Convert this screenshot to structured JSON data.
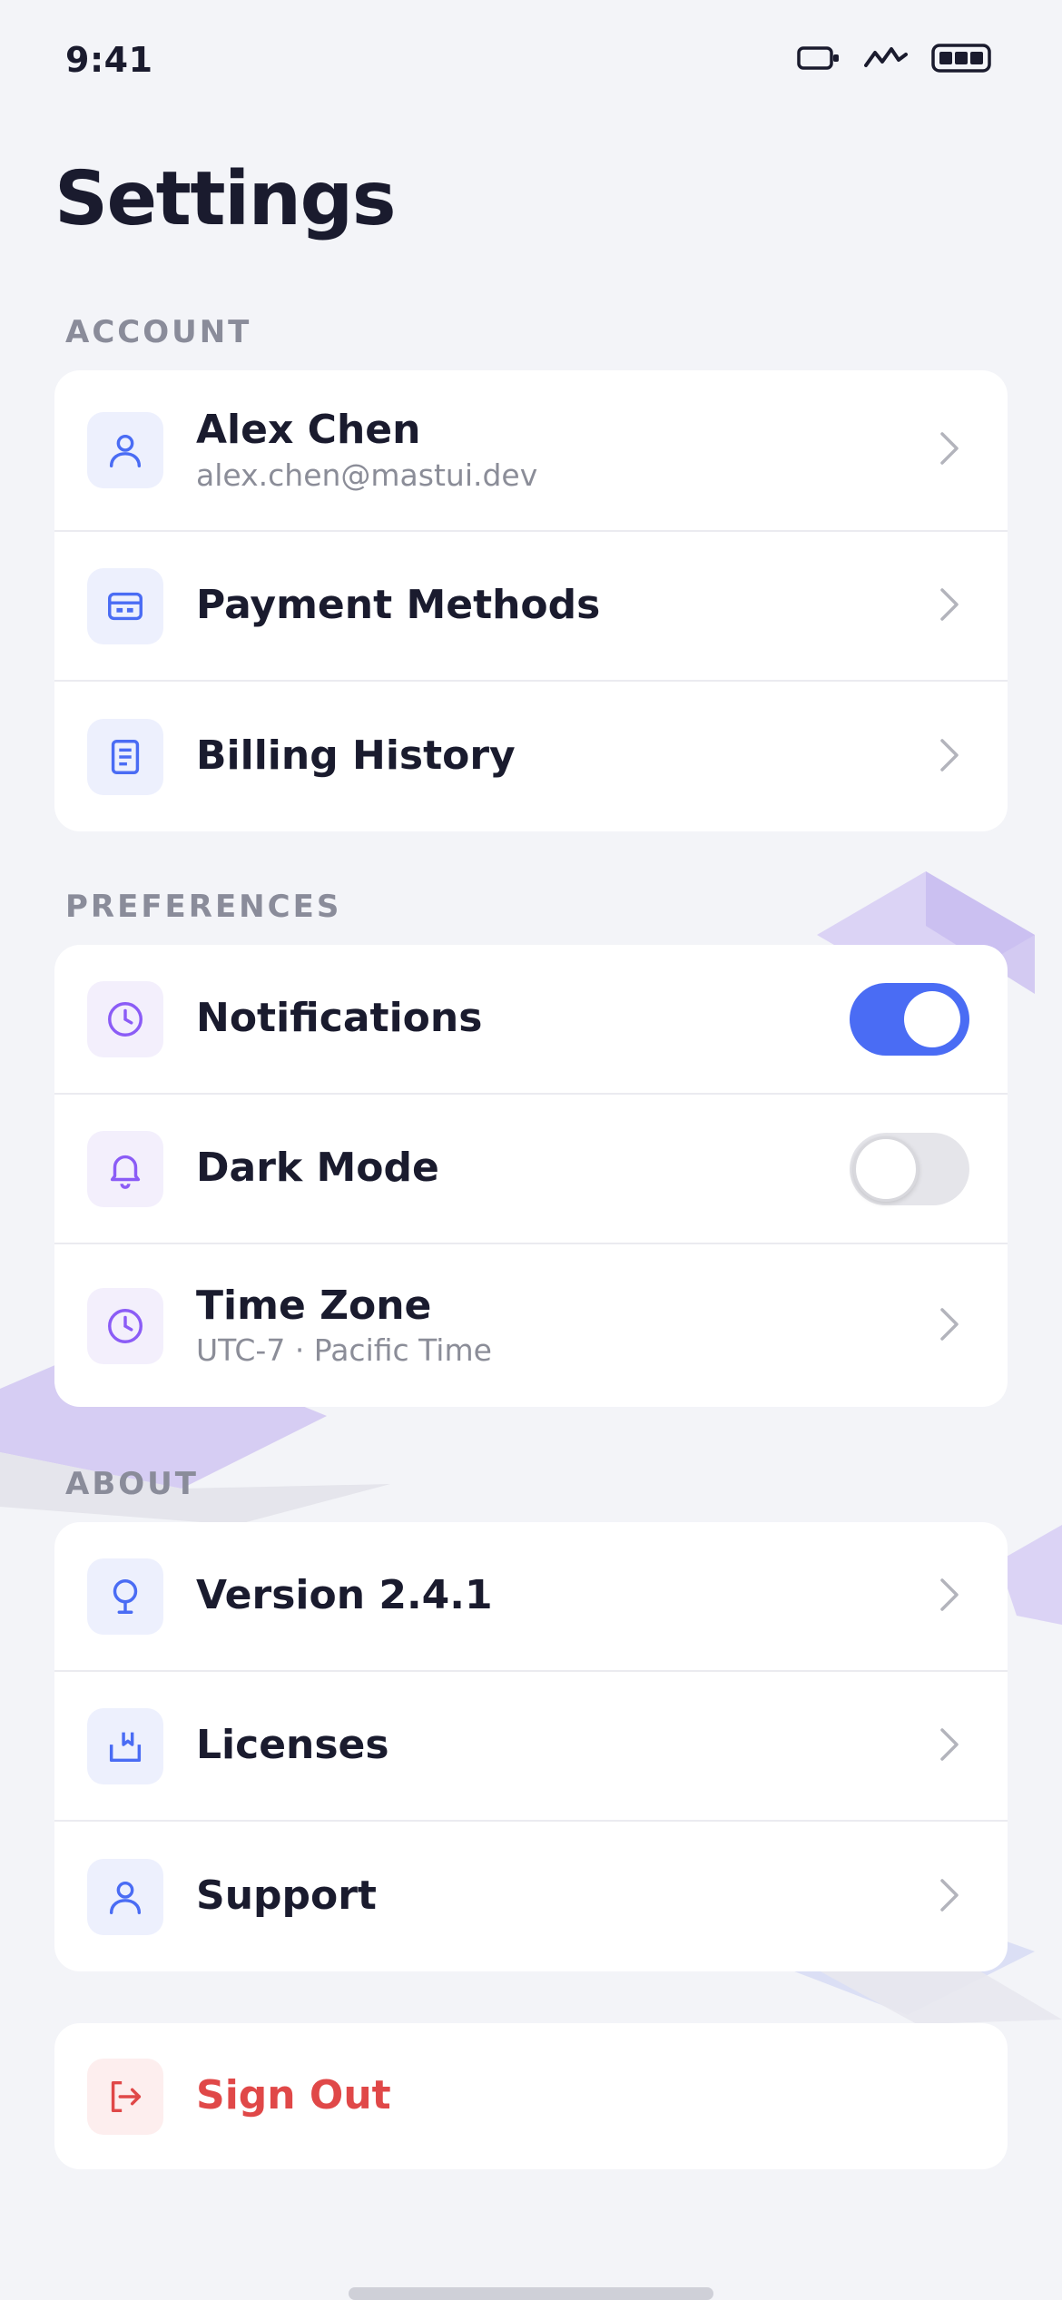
{
  "status_bar": {
    "time": "9:41"
  },
  "page": {
    "title": "Settings"
  },
  "sections": {
    "account": {
      "header": "ACCOUNT",
      "profile": {
        "name": "Alex Chen",
        "email": "alex.chen@mastui.dev",
        "icon": "user-icon"
      },
      "payment_methods": {
        "label": "Payment Methods",
        "icon": "credit-card-icon"
      },
      "billing_history": {
        "label": "Billing History",
        "icon": "document-icon"
      }
    },
    "preferences": {
      "header": "PREFERENCES",
      "notifications": {
        "label": "Notifications",
        "icon": "clock-icon",
        "enabled": true
      },
      "dark_mode": {
        "label": "Dark Mode",
        "icon": "bell-icon",
        "enabled": false
      },
      "time_zone": {
        "label": "Time Zone",
        "value": "UTC-7 · Pacific Time",
        "icon": "clock-icon"
      }
    },
    "about": {
      "header": "ABOUT",
      "version": {
        "label": "Version 2.4.1",
        "icon": "lightbulb-icon"
      },
      "licenses": {
        "label": "Licenses",
        "icon": "license-icon"
      },
      "support": {
        "label": "Support",
        "icon": "user-icon"
      }
    }
  },
  "sign_out": {
    "label": "Sign Out",
    "icon": "logout-icon"
  },
  "colors": {
    "accent": "#4a6cf4",
    "purple": "#8b5cf6",
    "danger": "#e04848",
    "background": "#f3f4f8"
  }
}
